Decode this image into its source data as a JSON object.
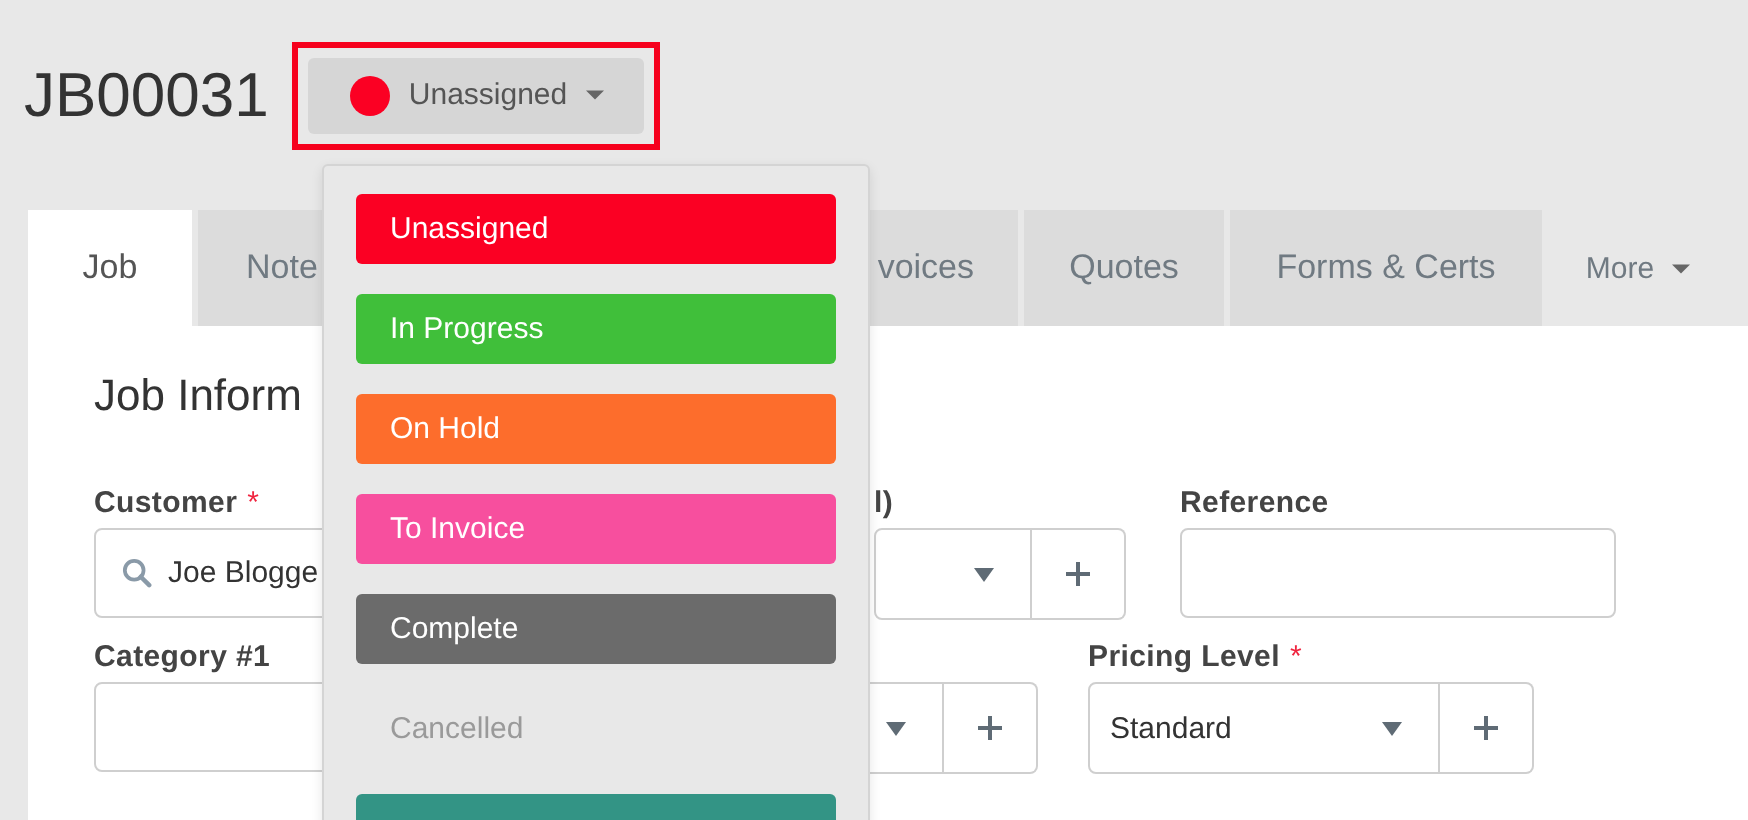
{
  "job_number": "JB00031",
  "status_button": {
    "label": "Unassigned",
    "color": "#fb0023",
    "highlighted": true
  },
  "tabs": [
    {
      "label": "Job",
      "selected": true
    },
    {
      "label": "Note",
      "selected": false
    },
    {
      "label": "voices",
      "selected": false
    },
    {
      "label": "Quotes",
      "selected": false
    },
    {
      "label": "Forms & Certs",
      "selected": false
    },
    {
      "label": "More",
      "selected": false,
      "kind": "menu"
    }
  ],
  "section_title": "Job Inform",
  "form_rows": [
    [
      {
        "label": "Customer",
        "required_mark": "*",
        "kind": "search",
        "value": "Joe Blogge"
      },
      {
        "label": "l)",
        "kind": "select-add"
      },
      {
        "label": "Reference",
        "kind": "text"
      }
    ],
    [
      {
        "label": "Category #1",
        "kind": "text"
      },
      {
        "kind": "select-add"
      },
      {
        "label": "Pricing Level",
        "required_mark": "*",
        "kind": "select-add",
        "value": "Standard"
      }
    ]
  ],
  "status_menu": [
    {
      "label": "Unassigned",
      "color": "#fb0023"
    },
    {
      "label": "In Progress",
      "color": "#40bf3a"
    },
    {
      "label": "On Hold",
      "color": "#fd6d2c"
    },
    {
      "label": "To Invoice",
      "color": "#f74f9e"
    },
    {
      "label": "Complete",
      "color": "#6b6b6b"
    },
    {
      "label": "Cancelled",
      "color": "#9a9a9a",
      "kind": "plain"
    },
    {
      "color": "#339485"
    }
  ]
}
